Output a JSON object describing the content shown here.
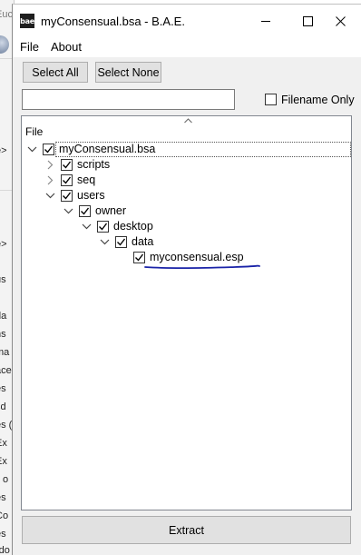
{
  "background_window": {
    "fragments": [
      "Euc",
      "e>",
      "e>",
      "us",
      "da",
      "ns",
      "ma",
      "ace",
      "es",
      "sd",
      "es (",
      "Ex",
      "Ex",
      "ll o",
      "es",
      "Co",
      "es",
      "rdo"
    ]
  },
  "window": {
    "icon_text": "bae",
    "title": "myConsensual.bsa - B.A.E."
  },
  "menu": {
    "items": [
      "File",
      "About"
    ]
  },
  "toolbar": {
    "select_all_label": "Select All",
    "select_none_label": "Select None"
  },
  "search": {
    "value": "",
    "placeholder": ""
  },
  "filename_only": {
    "label": "Filename Only",
    "checked": false
  },
  "tree": {
    "column_header": "File",
    "nodes": [
      {
        "label": "myConsensual.bsa",
        "depth": 0,
        "expander": "expanded",
        "checked": true
      },
      {
        "label": "scripts",
        "depth": 1,
        "expander": "collapsed",
        "checked": true
      },
      {
        "label": "seq",
        "depth": 1,
        "expander": "collapsed",
        "checked": true
      },
      {
        "label": "users",
        "depth": 1,
        "expander": "expanded",
        "checked": true
      },
      {
        "label": "owner",
        "depth": 2,
        "expander": "expanded",
        "checked": true
      },
      {
        "label": "desktop",
        "depth": 3,
        "expander": "expanded",
        "checked": true
      },
      {
        "label": "data",
        "depth": 4,
        "expander": "expanded",
        "checked": true
      },
      {
        "label": "myconsensual.esp",
        "depth": 5,
        "expander": "none",
        "checked": true
      }
    ]
  },
  "extract_label": "Extract",
  "colors": {
    "annotation_line": "#1a23a8",
    "panel_background": "#f0f0f0",
    "button_face": "#e1e1e1"
  }
}
